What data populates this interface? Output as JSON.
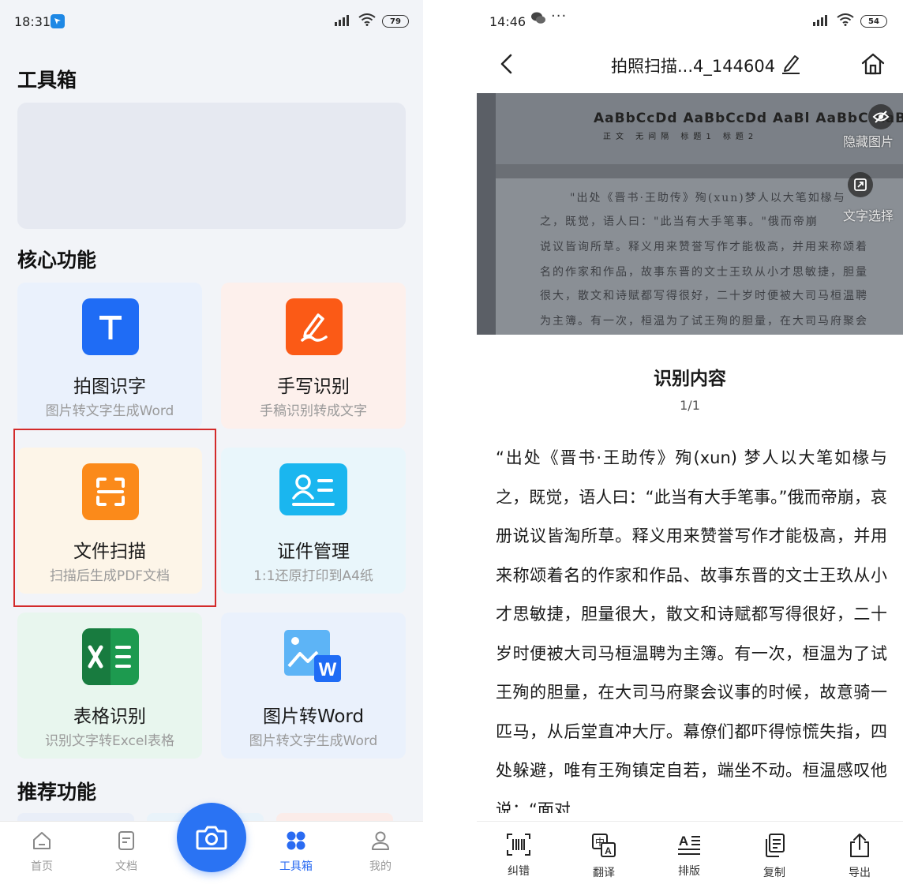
{
  "left": {
    "status": {
      "time": "18:31",
      "battery": "79"
    },
    "title": "工具箱",
    "core_title": "核心功能",
    "recommend_title": "推荐功能",
    "cards": [
      {
        "title": "拍图识字",
        "subtitle": "图片转文字生成Word",
        "icon": "text-t-icon",
        "bg": "#eaf1fc",
        "icon_bg": "#1f6cf5"
      },
      {
        "title": "手写识别",
        "subtitle": "手稿识别转成文字",
        "icon": "handwriting-pen-icon",
        "bg": "#fdf0ec",
        "icon_bg": "#fb5a16"
      },
      {
        "title": "文件扫描",
        "subtitle": "扫描后生成PDF文档",
        "icon": "scan-frame-icon",
        "bg": "#fdf5e8",
        "icon_bg": "#fb8a1a"
      },
      {
        "title": "证件管理",
        "subtitle": "1:1还原打印到A4纸",
        "icon": "id-card-icon",
        "bg": "#e9f6fb",
        "icon_bg": "#1ab6ef"
      },
      {
        "title": "表格识别",
        "subtitle": "识别文字转Excel表格",
        "icon": "excel-icon",
        "bg": "#e8f6ee",
        "icon_bg": "#1d9a4f"
      },
      {
        "title": "图片转Word",
        "subtitle": "图片转文字生成Word",
        "icon": "image-to-word-icon",
        "bg": "#eaf1fc",
        "icon_bg": "#4aa9f2"
      }
    ],
    "nav": [
      {
        "label": "首页",
        "icon": "home-icon"
      },
      {
        "label": "文档",
        "icon": "document-icon"
      },
      {
        "label": "工具箱",
        "icon": "grid-icon"
      },
      {
        "label": "我的",
        "icon": "user-icon"
      }
    ],
    "accent": "#2a6bf2",
    "highlight_color": "#d32a2a"
  },
  "right": {
    "status": {
      "time": "14:46",
      "battery": "54"
    },
    "title": "拍照扫描...4_144604",
    "overlay": {
      "hide_image": "隐藏图片",
      "select_text": "文字选择"
    },
    "photo_text": {
      "ribbon": "AaBbCcDd  AaBbCcDd  AaBl  AaBbC  AaBbC  AaBbC",
      "ribbon_caption": "正文   无间隔   标题1   标题2",
      "lines": [
        "\"出处《晋书·王助传》殉(xun)梦人以大笔如椽与",
        "之，既觉，语人曰：\"此当有大手笔事。\"俄而帝崩",
        "说议皆询所草。释义用来赞誉写作才能极高，并用来称颂着",
        "名的作家和作品，故事东晋的文士王玖从小才思敏捷，胆量",
        "很大，散文和诗赋都写得很好，二十岁时便被大司马桓温聘",
        "为主簿。有一次，桓温为了试王殉的胆量，在大司马府聚会"
      ]
    },
    "result_title": "识别内容",
    "page_indicator": "1/1",
    "recognized_text": "“出处《晋书·王助传》殉(xun) 梦人以大笔如椽与之，既觉，语人曰：“此当有大手笔事。”俄而帝崩，哀册说议皆淘所草。释义用来赞誉写作才能极高，并用来称颂着名的作家和作品、故事东晋的文士王玖从小才思敏捷，胆量很大，散文和诗赋都写得很好，二十岁时便被大司马桓温聘为主簿。有一次，桓温为了试王殉的胆量，在大司马府聚会议事的时候，故意骑一匹马，从后堂直冲大厅。幕僚们都吓得惊慌失指，四处躲避，唯有王殉镇定自若，端坐不动。桓温感叹他说：“面对",
    "tools": [
      {
        "label": "纠错",
        "icon": "barcode-scan-icon"
      },
      {
        "label": "翻译",
        "icon": "translate-icon"
      },
      {
        "label": "排版",
        "icon": "text-layout-icon"
      },
      {
        "label": "复制",
        "icon": "copy-icon"
      },
      {
        "label": "导出",
        "icon": "export-icon"
      }
    ]
  }
}
